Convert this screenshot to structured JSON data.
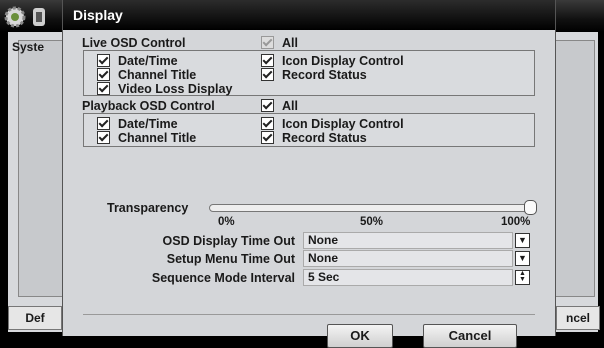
{
  "background": {
    "tab_label": "Syste",
    "default_button": "Def",
    "cancel_button": "ncel"
  },
  "dialog": {
    "title": "Display",
    "live_osd": {
      "label": "Live OSD Control",
      "all_label": "All",
      "all_checked": true,
      "items": [
        {
          "label": "Date/Time",
          "checked": true
        },
        {
          "label": "Icon Display Control",
          "checked": true
        },
        {
          "label": "Channel Title",
          "checked": true
        },
        {
          "label": "Record Status",
          "checked": true
        },
        {
          "label": "Video Loss Display",
          "checked": true
        }
      ]
    },
    "playback_osd": {
      "label": "Playback OSD Control",
      "all_label": "All",
      "all_checked": true,
      "items": [
        {
          "label": "Date/Time",
          "checked": true
        },
        {
          "label": "Icon Display Control",
          "checked": true
        },
        {
          "label": "Channel Title",
          "checked": true
        },
        {
          "label": "Record Status",
          "checked": true
        }
      ]
    },
    "transparency": {
      "label": "Transparency",
      "value_percent": 100,
      "tick_labels": [
        "0%",
        "50%",
        "100%"
      ]
    },
    "settings": [
      {
        "label": "OSD Display Time Out",
        "value": "None"
      },
      {
        "label": "Setup Menu Time Out",
        "value": "None"
      },
      {
        "label": "Sequence Mode Interval",
        "value": "5 Sec"
      }
    ],
    "ok_label": "OK",
    "cancel_label": "Cancel"
  },
  "colors": {
    "title_bar": "#000000",
    "dialog_bg": "#d4d6d9"
  }
}
